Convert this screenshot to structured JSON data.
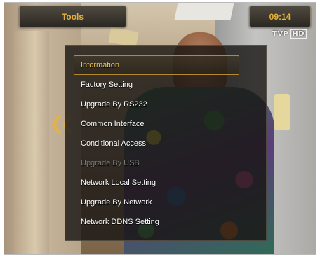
{
  "header": {
    "title": "Tools",
    "clock": "09:14"
  },
  "channel_logo": {
    "name": "TVP",
    "hd": "HD"
  },
  "menu": {
    "items": [
      {
        "label": "Information",
        "state": "selected"
      },
      {
        "label": "Factory Setting",
        "state": "normal"
      },
      {
        "label": "Upgrade By RS232",
        "state": "normal"
      },
      {
        "label": "Common Interface",
        "state": "normal"
      },
      {
        "label": "Conditional Access",
        "state": "normal"
      },
      {
        "label": "Upgrade By USB",
        "state": "disabled"
      },
      {
        "label": "Network Local Setting",
        "state": "normal"
      },
      {
        "label": "Upgrade By Network",
        "state": "normal"
      },
      {
        "label": "Network DDNS Setting",
        "state": "normal"
      }
    ]
  },
  "colors": {
    "accent": "#e4b23c",
    "selected_border": "#b48a2a",
    "disabled_text": "#7d7b77"
  },
  "icons": {
    "left_arrow": "double-chevron-left-icon"
  }
}
